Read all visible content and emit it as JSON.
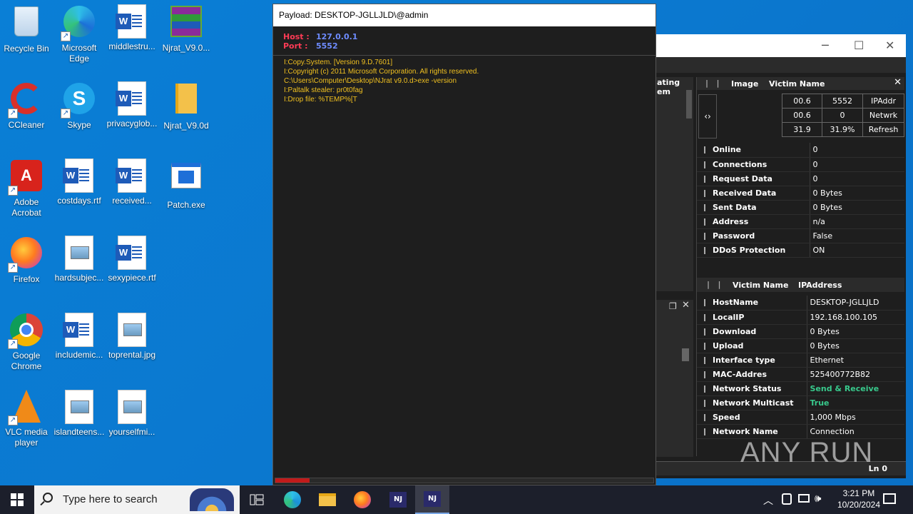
{
  "desktop": {
    "icons": [
      {
        "label": "Recycle Bin",
        "icon": "recycle-bin-icon"
      },
      {
        "label": "Microsoft Edge",
        "icon": "edge-icon"
      },
      {
        "label": "middlestru...",
        "icon": "word-doc-icon"
      },
      {
        "label": "Njrat_V9.0...",
        "icon": "winrar-icon"
      },
      {
        "label": "CCleaner",
        "icon": "ccleaner-icon"
      },
      {
        "label": "Skype",
        "icon": "skype-icon"
      },
      {
        "label": "privacyglob...",
        "icon": "word-doc-icon"
      },
      {
        "label": "Njrat_V9.0d",
        "icon": "folder-icon"
      },
      {
        "label": "Adobe Acrobat",
        "icon": "acrobat-icon"
      },
      {
        "label": "costdays.rtf",
        "icon": "word-doc-icon"
      },
      {
        "label": "received...",
        "icon": "word-doc-icon"
      },
      {
        "label": "Patch.exe",
        "icon": "exe-icon"
      },
      {
        "label": "Firefox",
        "icon": "firefox-icon"
      },
      {
        "label": "hardsubjec...",
        "icon": "image-file-icon"
      },
      {
        "label": "sexypiece.rtf",
        "icon": "word-doc-icon"
      },
      {
        "label": "Google Chrome",
        "icon": "chrome-icon"
      },
      {
        "label": "includemic...",
        "icon": "word-doc-icon"
      },
      {
        "label": "toprental.jpg",
        "icon": "image-file-icon"
      },
      {
        "label": "VLC media player",
        "icon": "vlc-icon"
      },
      {
        "label": "islandteens...",
        "icon": "image-file-icon"
      },
      {
        "label": "yourselfmi...",
        "icon": "image-file-icon"
      }
    ]
  },
  "payload_window": {
    "title": "Payload: DESKTOP-JGLLJLD\\@admin",
    "host_label": "Host :",
    "host_value": "127.0.0.1",
    "port_label": "Port :",
    "port_value": "5552",
    "console_lines": [
      "I:Copy.System. [Version 9.D.7601]",
      "I:Copyright (c) 2011 Microsoft Corporation.  All rights reserved.",
      "C:\\Users\\Computer\\Desktop\\NJrat v9.0.d>exe -version",
      "I:Paltalk stealer: pr0t0fag",
      "I:Drop file: %TEMP%[T"
    ],
    "progress": 0.09,
    "progress_color": "#c21b1b"
  },
  "main_window": {
    "partial_left_text": [
      "ating",
      "em"
    ],
    "top_header": {
      "col1": "Image",
      "col2": "Victim Name"
    },
    "arrows": "‹›",
    "stats_grid": [
      [
        "00.6",
        "5552",
        "IPAddr"
      ],
      [
        "00.6",
        "0",
        "Netwrk"
      ],
      [
        "31.9",
        "31.9%",
        "Refresh"
      ]
    ],
    "status_rows": [
      {
        "key": "Online",
        "value": "0"
      },
      {
        "key": "Connections",
        "value": "0"
      },
      {
        "key": "Request Data",
        "value": "0"
      },
      {
        "key": "Received Data",
        "value": "0 Bytes"
      },
      {
        "key": "Sent Data",
        "value": "0 Bytes"
      },
      {
        "key": "Address",
        "value": "n/a"
      },
      {
        "key": "Password",
        "value": "False"
      },
      {
        "key": "DDoS Protection",
        "value": "ON"
      }
    ],
    "bottom_header": {
      "col1": "Victim Name",
      "col2": "IPAddress"
    },
    "network_rows": [
      {
        "key": "HostName",
        "value": "DESKTOP-JGLLJLD"
      },
      {
        "key": "LocalIP",
        "value": "192.168.100.105"
      },
      {
        "key": "Download",
        "value": "0 Bytes"
      },
      {
        "key": "Upload",
        "value": "0 Bytes"
      },
      {
        "key": "Interface type",
        "value": "Ethernet"
      },
      {
        "key": "MAC-Addres",
        "value": "525400772B82"
      },
      {
        "key": "Network Status",
        "value": "Send & Receive"
      },
      {
        "key": "Network Multicast",
        "value": "True"
      },
      {
        "key": "Speed",
        "value": "1,000 Mbps"
      },
      {
        "key": "Network Name",
        "value": "Connection"
      }
    ],
    "status_bar": "Ln  0",
    "watermark": "ANY RUN",
    "accent_green": "#38c98c"
  },
  "taskbar": {
    "search_placeholder": "Type here to search",
    "time": "3:21 PM",
    "date": "10/20/2024"
  }
}
